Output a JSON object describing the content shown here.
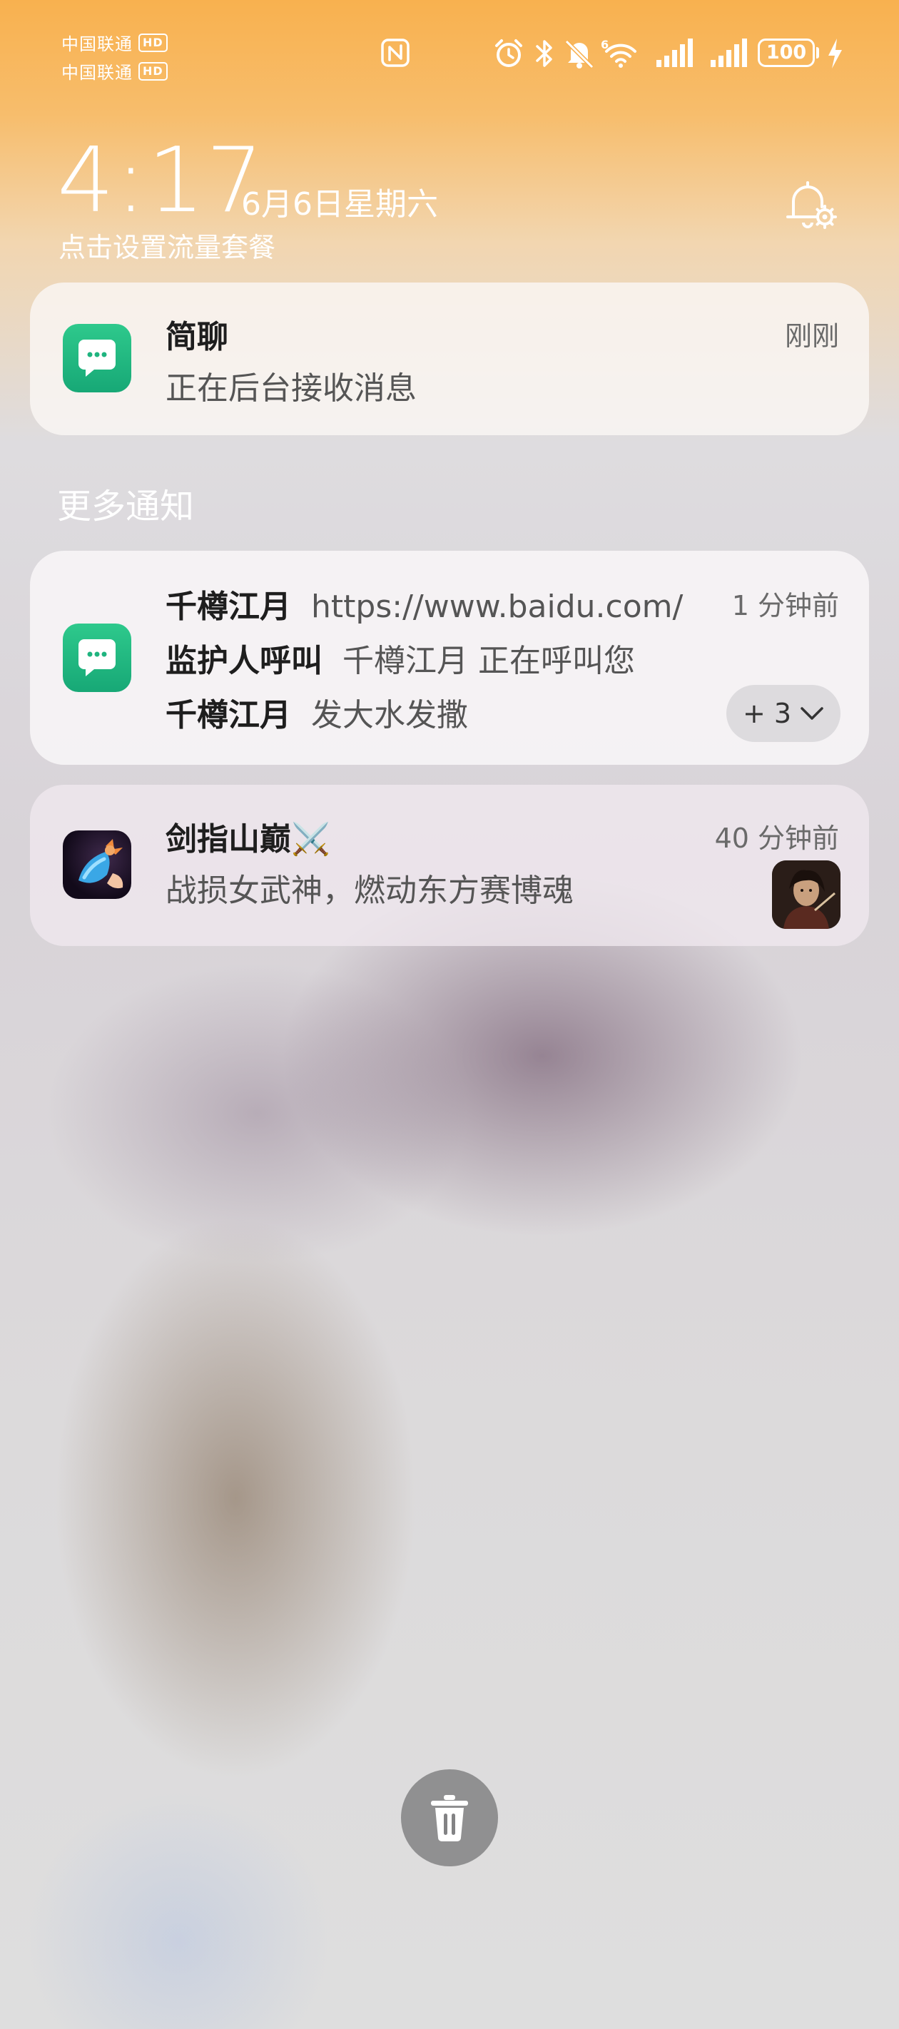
{
  "status_bar": {
    "carrier_1": "中国联通",
    "carrier_2": "中国联通",
    "hd_badge": "HD",
    "battery_level": "100",
    "icons": [
      "nfc-icon",
      "alarm-icon",
      "bluetooth-icon",
      "mute-icon",
      "wifi-6-icon",
      "signal-icon",
      "signal-icon",
      "battery-icon",
      "charging-icon"
    ]
  },
  "lockscreen": {
    "time": "4:17",
    "date": "6月6日星期六",
    "data_plan_link": "点击设置流量套餐"
  },
  "notifications": {
    "ongoing": {
      "app_name": "简聊",
      "text": "正在后台接收消息",
      "time": "刚刚",
      "icon": "chat-app-icon"
    },
    "more_header": "更多通知",
    "chat_group": {
      "time": "1 分钟前",
      "icon": "chat-app-icon",
      "lines": [
        {
          "sender": "千樽江月",
          "message": "https://www.baidu.com/"
        },
        {
          "sender": "监护人呼叫",
          "message": "千樽江月 正在呼叫您"
        },
        {
          "sender": "千樽江月",
          "message": "发大水发撒"
        }
      ],
      "more_count": "+ 3"
    },
    "game": {
      "app_name": "剑指山巅",
      "title_emoji": "⚔️",
      "text": "战损女武神，燃动东方赛博魂",
      "time": "40 分钟前",
      "icon": "game-app-icon"
    }
  },
  "clear_all": {
    "icon": "trash-icon"
  },
  "colors": {
    "top_gradient": "#f8b14f",
    "chat_icon_green": "#1fb47f",
    "card_bg": "#f7f5f5"
  }
}
